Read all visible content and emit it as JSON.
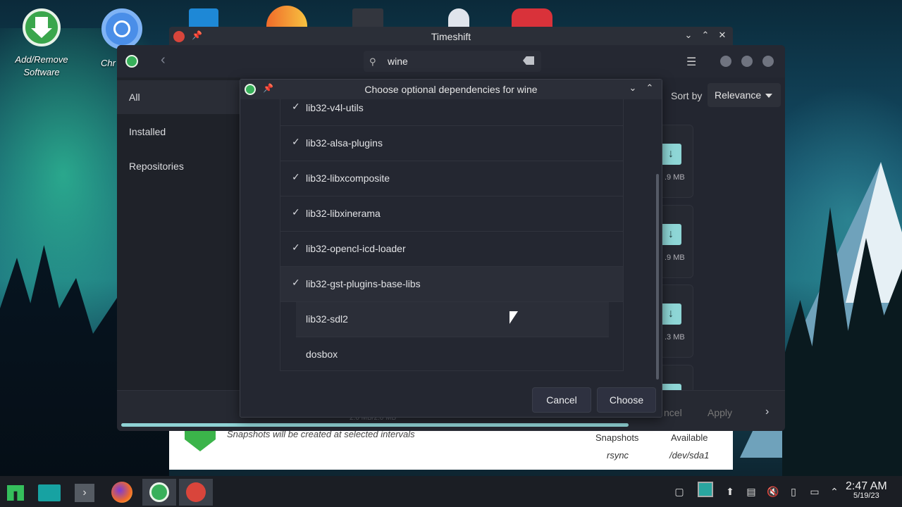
{
  "desktop": {
    "icons": [
      {
        "label": "Add/Remove Software"
      },
      {
        "label": "Chr"
      }
    ]
  },
  "timeshift": {
    "title": "Timeshift",
    "message": "Snapshots will be created at selected intervals",
    "col1_header": "Snapshots",
    "col1_value": "rsync",
    "col2_header": "Available",
    "col2_value": "/dev/sda1"
  },
  "pamac": {
    "search_value": "wine",
    "sidebar": {
      "items": [
        {
          "label": "All"
        },
        {
          "label": "Installed"
        },
        {
          "label": "Repositories"
        }
      ]
    },
    "sort_label": "Sort by",
    "sort_value": "Relevance",
    "cards": [
      {
        "size": ".9 MB"
      },
      {
        "size": ".9 MB"
      },
      {
        "size": ".3 MB"
      }
    ],
    "footer": {
      "cancel_partial": "ncel",
      "apply": "Apply",
      "progress_text": "2.0 MB/2.0 MB",
      "progress_fraction": 1.0
    }
  },
  "dialog": {
    "title": "Choose optional dependencies for wine",
    "deps": [
      {
        "name": "lib32-v4l-utils",
        "checked": true
      },
      {
        "name": "lib32-alsa-plugins",
        "checked": true
      },
      {
        "name": "lib32-libxcomposite",
        "checked": true
      },
      {
        "name": "lib32-libxinerama",
        "checked": true
      },
      {
        "name": "lib32-opencl-icd-loader",
        "checked": true
      },
      {
        "name": "lib32-gst-plugins-base-libs",
        "checked": true
      },
      {
        "name": "lib32-sdl2",
        "checked": false
      },
      {
        "name": "dosbox",
        "checked": false
      }
    ],
    "cancel": "Cancel",
    "choose": "Choose"
  },
  "taskbar": {
    "time": "2:47 AM",
    "date": "5/19/23"
  }
}
